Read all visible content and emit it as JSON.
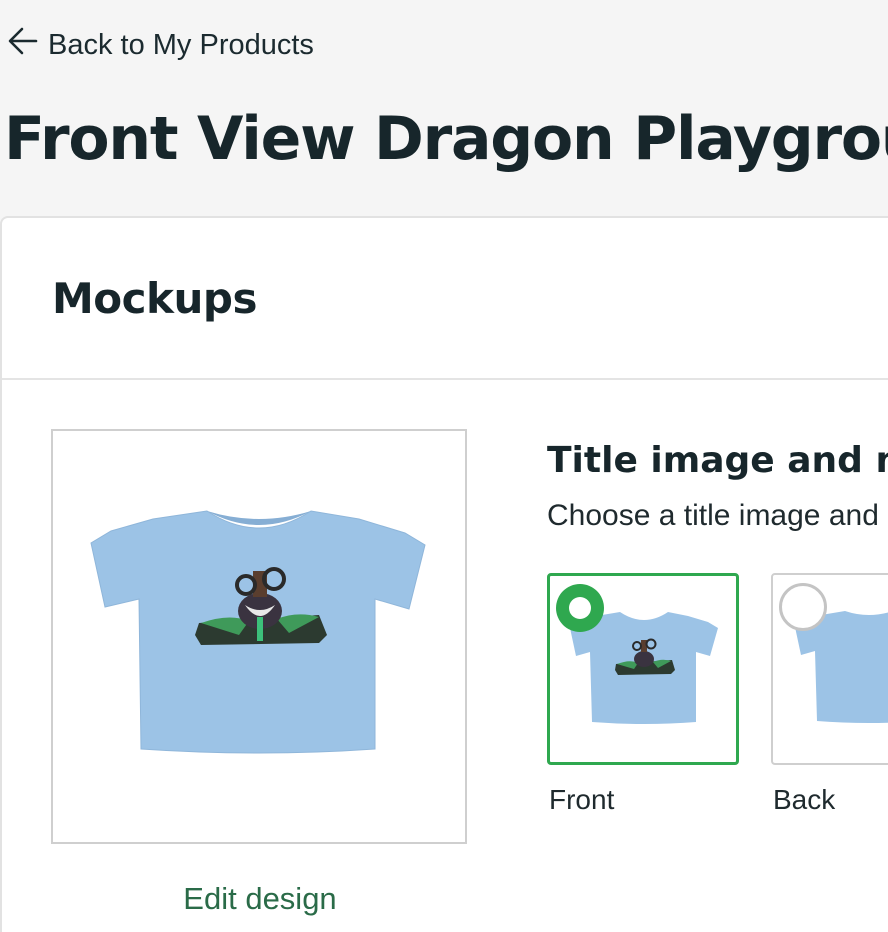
{
  "header": {
    "back_label": "Back to My Products",
    "back_icon": "arrow-left-icon",
    "product_title": "Front View Dragon Playground"
  },
  "mockups": {
    "title": "Mockups",
    "edit_design_label": "Edit design",
    "section_title": "Title image and mo",
    "section_description": "Choose a title image and",
    "options": [
      {
        "label": "Front",
        "selected": true
      },
      {
        "label": "Back",
        "selected": false
      }
    ]
  },
  "colors": {
    "accent_green": "#2fa84f",
    "link_green": "#2a6b48",
    "shirt_blue": "#9cc3e6",
    "title_dark": "#17262b"
  }
}
